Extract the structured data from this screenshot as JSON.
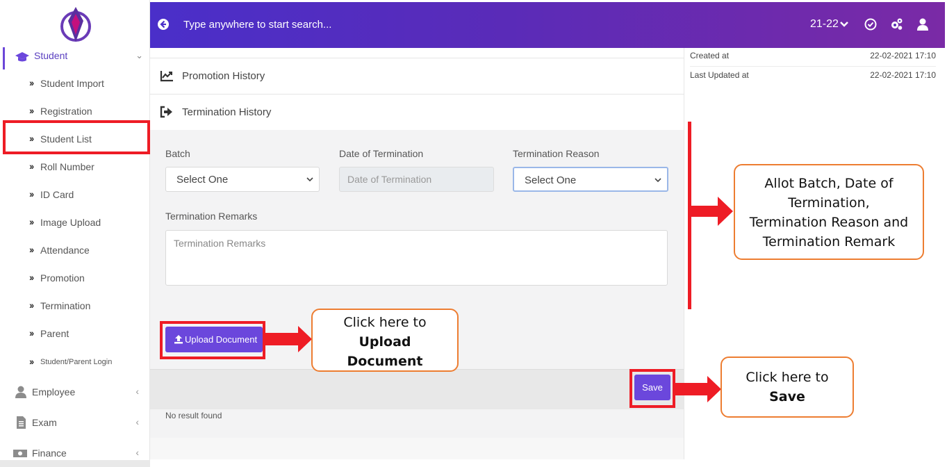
{
  "sidebar": {
    "logo": "diamond-logo-icon",
    "student_menu": {
      "label": "Student",
      "icon": "graduation-cap-icon"
    },
    "sub_items": [
      {
        "label": "Student Import"
      },
      {
        "label": "Registration"
      },
      {
        "label": "Student List"
      },
      {
        "label": "Roll Number"
      },
      {
        "label": "ID Card"
      },
      {
        "label": "Image Upload"
      },
      {
        "label": "Attendance"
      },
      {
        "label": "Promotion"
      },
      {
        "label": "Termination"
      },
      {
        "label": "Parent"
      },
      {
        "label": "Student/Parent Login"
      }
    ],
    "main_items": [
      {
        "label": "Employee",
        "icon": "user-icon"
      },
      {
        "label": "Exam",
        "icon": "document-icon"
      },
      {
        "label": "Finance",
        "icon": "money-icon"
      }
    ]
  },
  "header": {
    "search_placeholder": "Type anywhere to start search...",
    "year": "21-22"
  },
  "history": {
    "promotion": "Promotion History",
    "termination": "Termination History"
  },
  "form": {
    "batch_label": "Batch",
    "batch_value": "Select One",
    "date_label": "Date of Termination",
    "date_placeholder": "Date of Termination",
    "reason_label": "Termination Reason",
    "reason_value": "Select One",
    "remarks_label": "Termination Remarks",
    "remarks_placeholder": "Termination Remarks",
    "upload_label": "Upload Document",
    "save_label": "Save",
    "no_result": "No result found"
  },
  "info": {
    "created_label": "Created at",
    "created_value": "22-02-2021 17:10",
    "updated_label": "Last Updated at",
    "updated_value": "22-02-2021 17:10"
  },
  "annotations": {
    "allot": [
      "Allot Batch, Date of",
      "Termination,",
      "Termination Reason and",
      "Termination Remark"
    ],
    "upload": [
      "Click here to",
      "Upload",
      "Document"
    ],
    "save": [
      "Click here to",
      "Save"
    ]
  },
  "colors": {
    "accent": "#6b47dc",
    "highlight": "#ee1c25",
    "callout_border": "#ed7d31"
  }
}
